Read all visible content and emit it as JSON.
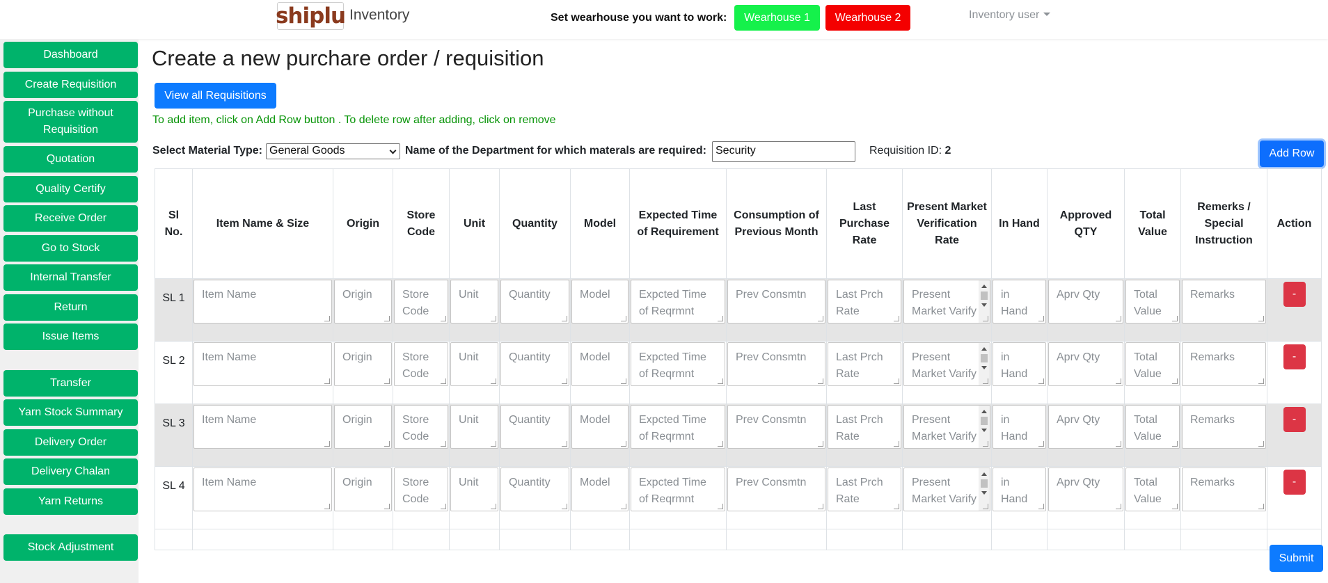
{
  "header": {
    "logo_text": "shiplu",
    "app_name": "Inventory",
    "warehouse_prompt": "Set wearhouse you want to work:",
    "warehouses": [
      "Wearhouse 1",
      "Wearhouse 2"
    ],
    "user_menu": "Inventory user"
  },
  "sidebar": {
    "items": [
      {
        "label": "Dashboard"
      },
      {
        "label": "Create Requisition"
      },
      {
        "label": "Purchase without Requisition"
      },
      {
        "label": "Quotation"
      },
      {
        "label": "Quality Certify"
      },
      {
        "label": "Receive Order"
      },
      {
        "label": "Go to Stock"
      },
      {
        "label": "Internal Transfer"
      },
      {
        "label": "Return"
      },
      {
        "label": "Issue Items"
      },
      {
        "label": "Transfer"
      },
      {
        "label": "Yarn Stock Summary"
      },
      {
        "label": "Delivery Order"
      },
      {
        "label": "Delivery Chalan"
      },
      {
        "label": "Yarn Returns"
      },
      {
        "label": "Stock Adjustment"
      }
    ]
  },
  "main": {
    "title": "Create a new purchare order / requisition",
    "view_all_label": "View all Requisitions",
    "hint": "To add item, click on Add Row button . To delete row after adding, click on remove",
    "material_type_label": "Select Material Type:",
    "material_type_value": "General Goods",
    "department_label": "Name of the Department for which materals are required:",
    "department_value": "Security",
    "requisition_id_label": "Requisition ID:",
    "requisition_id_value": "2",
    "add_row_label": "Add Row",
    "submit_label": "Submit",
    "remove_label": "-"
  },
  "table": {
    "headers": [
      "Sl No.",
      "Item Name & Size",
      "Origin",
      "Store Code",
      "Unit",
      "Quantity",
      "Model",
      "Expected Time of Requirement",
      "Consumption of Previous Month",
      "Last Purchase Rate",
      "Present Market Verification Rate",
      "In Hand",
      "Approved QTY",
      "Total Value",
      "Remerks / Special Instruction",
      "Action"
    ],
    "placeholders": [
      "Item Name",
      "Origin",
      "Store Code",
      "Unit",
      "Quantity",
      "Model",
      "Expcted Time of Reqrmnt",
      "Prev Consmtn",
      "Last Prch Rate",
      "Present Market Varify Rate",
      "in Hand",
      "Aprv Qty",
      "Total Value",
      "Remarks"
    ],
    "rows": [
      {
        "sl": "SL 1"
      },
      {
        "sl": "SL 2"
      },
      {
        "sl": "SL 3"
      },
      {
        "sl": "SL 4"
      }
    ]
  }
}
